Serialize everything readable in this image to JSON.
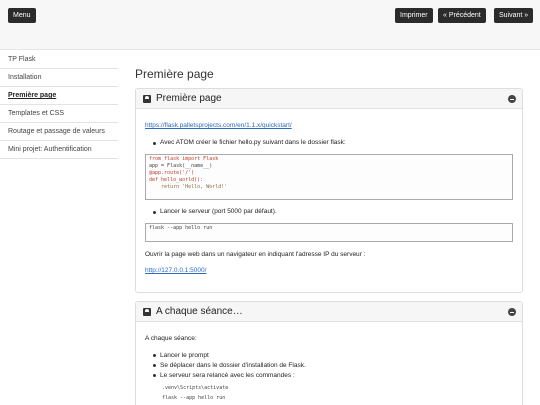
{
  "topbar": {
    "menu_label": "Menu",
    "print_label": "Imprimer",
    "prev_label": "« Précédent",
    "next_label": "Suivant »"
  },
  "sidebar": {
    "items": [
      {
        "label": "TP Flask"
      },
      {
        "label": "Installation"
      },
      {
        "label": "Première page",
        "active": true
      },
      {
        "label": "Templates et CSS"
      },
      {
        "label": "Routage et passage de valeurs"
      },
      {
        "label": "Mini projet: Authentification"
      }
    ]
  },
  "main": {
    "page_title": "Première page",
    "card1": {
      "title": "Première page",
      "link": "https://flask.palletsprojects.com/en/1.1.x/quickstart/",
      "step1": "Avec ATOM créer le fichier hello.py suivant dans le dossier flask:",
      "code1": [
        "from flask import Flask",
        "app = Flask(__name__)",
        "@app.route('/')",
        "def hello_world():",
        "    return 'Hello, World!'"
      ],
      "step2": "Lancer le serveur (port 5000 par défaut).",
      "code2": "flask --app hello run",
      "para": "Ouvrir la page web dans un navigateur en indiquant l'adresse IP du serveur :",
      "link2": "http://127.0.0.1:5000/"
    },
    "card2": {
      "title": "A chaque séance…",
      "intro": "A chaque séance:",
      "items": [
        "Lancer le prompt",
        "Se déplacer dans le dossier d'installation de Flask.",
        "Le serveur sera relancé avec les commandes :"
      ],
      "cmd1": ".venv\\Scripts\\activate",
      "cmd2": "flask --app hello run"
    }
  }
}
